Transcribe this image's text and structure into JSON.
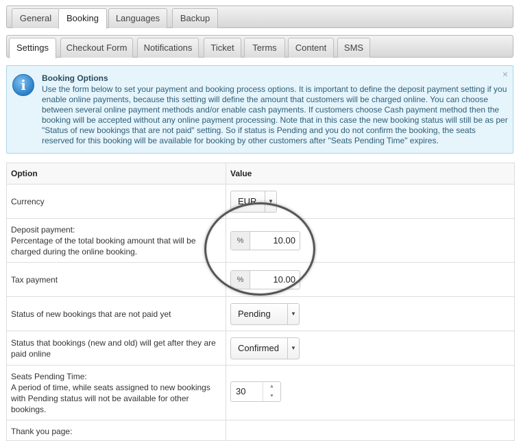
{
  "main_tabs": [
    {
      "label": "General"
    },
    {
      "label": "Booking"
    },
    {
      "label": "Languages"
    },
    {
      "label": "Backup"
    }
  ],
  "sub_tabs": [
    {
      "label": "Settings"
    },
    {
      "label": "Checkout Form"
    },
    {
      "label": "Notifications"
    },
    {
      "label": "Ticket"
    },
    {
      "label": "Terms"
    },
    {
      "label": "Content"
    },
    {
      "label": "SMS"
    }
  ],
  "info": {
    "title": "Booking Options",
    "close": "×",
    "icon": "info-icon",
    "line1": "Use the form below to set your payment and booking process options. It is important to define the deposit payment setting if you enable online payments, because this setting will define the amount that customers will be charged online. You can choose between several online payment methods and/or enable cash payments. If customers choose Cash payment method then the booking will be accepted without any online payment processing. Note that in this case the new booking status will still be as per \"Status of new bookings that are not paid\" setting. So if status is Pending and you do not confirm the booking, the seats reserved for this booking will be available for booking by other customers after \"Seats Pending Time\" expires."
  },
  "table": {
    "header_option": "Option",
    "header_value": "Value",
    "currency_label": "Currency",
    "currency_value": "EUR",
    "deposit_title": "Deposit payment:",
    "deposit_desc": "Percentage of the total booking amount that will be charged during the online booking.",
    "deposit_addon": "%",
    "deposit_value": "10.00",
    "tax_label": "Tax payment",
    "tax_addon": "%",
    "tax_value": "10.00",
    "status_new_label": "Status of new bookings that are not paid yet",
    "status_new_value": "Pending",
    "status_paid_label": "Status that bookings (new and old) will get after they are paid online",
    "status_paid_value": "Confirmed",
    "seats_title": "Seats Pending Time:",
    "seats_desc": "A period of time, while seats assigned to new bookings with Pending status will not be available for other bookings.",
    "seats_value": "30",
    "thankyou_title": "Thank you page:"
  },
  "colors": {
    "info_bg": "#e6f4fb",
    "info_text": "#2d5f78"
  }
}
